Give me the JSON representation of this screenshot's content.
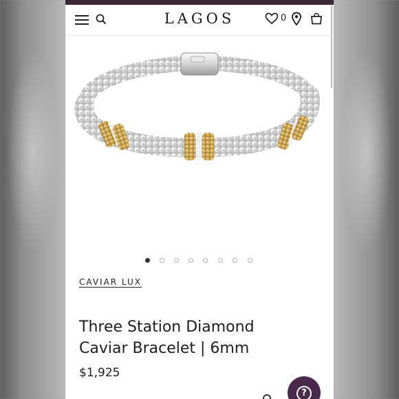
{
  "header": {
    "logo": "LAGOS",
    "wishlist_count": "0",
    "icons": [
      "menu-icon",
      "search-icon",
      "heart-icon",
      "location-pin-icon",
      "shopping-bag-icon"
    ]
  },
  "gallery": {
    "image_count": 8,
    "active_index": 0
  },
  "product": {
    "collection": "CAVIAR LUX",
    "title": "Three Station Diamond Caviar Bracelet | 6mm",
    "price": "$1,925"
  },
  "help": {
    "icon": "help-question-icon",
    "glyph": "?"
  },
  "colors": {
    "brand_bar": "#3d2638",
    "help_button": "#4a2a4c",
    "text": "#1d1d1d"
  }
}
